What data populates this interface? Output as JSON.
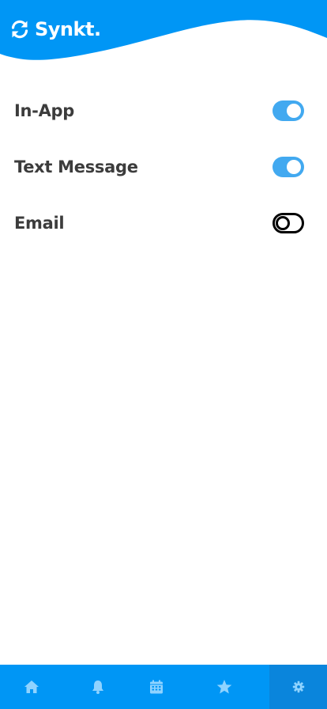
{
  "app": {
    "name": "Synkt.",
    "logo_icon": "sync-icon"
  },
  "colors": {
    "brand": "#0096f5",
    "toggle_on": "#42a9f0",
    "toggle_off_border": "#000000",
    "nav_icon": "#8fd3ff",
    "nav_active_bg": "#0a85dc",
    "label_text": "#3c3c3c"
  },
  "settings": {
    "items": [
      {
        "label": "In-App",
        "enabled": true
      },
      {
        "label": "Text Message",
        "enabled": true
      },
      {
        "label": "Email",
        "enabled": false
      }
    ]
  },
  "nav": {
    "items": [
      {
        "icon": "home-icon",
        "active": false
      },
      {
        "icon": "bell-icon",
        "active": false
      },
      {
        "icon": "calendar-icon",
        "active": false
      },
      {
        "icon": "star-icon",
        "active": false
      },
      {
        "icon": "gear-icon",
        "active": true
      }
    ]
  }
}
